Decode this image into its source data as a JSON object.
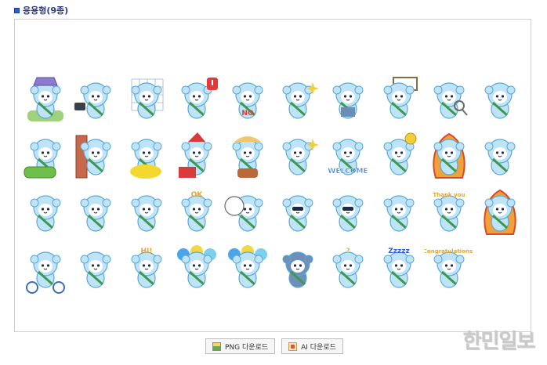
{
  "section": {
    "title": "응용형(9종)"
  },
  "stickers": {
    "rows": [
      [
        {
          "name": "purple-hat-mascot",
          "prop": "hat",
          "text": ""
        },
        {
          "name": "camera-mascot",
          "prop": "camera",
          "text": ""
        },
        {
          "name": "grid-window-mascot",
          "prop": "grid",
          "text": ""
        },
        {
          "name": "exclaim-mascot",
          "prop": "exclaim",
          "text": ""
        },
        {
          "name": "no-mascot",
          "prop": "textred",
          "text": "NO"
        },
        {
          "name": "sparkle-mascot",
          "prop": "sparkle",
          "text": ""
        },
        {
          "name": "book-mascot",
          "prop": "book",
          "text": ""
        },
        {
          "name": "sign-mascot",
          "prop": "sign",
          "text": ""
        },
        {
          "name": "magnifier-mascot",
          "prop": "magnifier",
          "text": ""
        },
        {
          "name": "wave-mascot",
          "prop": "none",
          "text": ""
        }
      ],
      [
        {
          "name": "car-mascot",
          "prop": "car",
          "text": ""
        },
        {
          "name": "door-peek-mascot",
          "prop": "door",
          "text": ""
        },
        {
          "name": "yellow-blob-mascot",
          "prop": "blob",
          "text": ""
        },
        {
          "name": "santa-gift-mascot",
          "prop": "santa",
          "text": ""
        },
        {
          "name": "harvest-mascot",
          "prop": "harvest",
          "text": ""
        },
        {
          "name": "cheer-mascot",
          "prop": "sparkle",
          "text": ""
        },
        {
          "name": "welcome-mascot",
          "prop": "welcome",
          "text": "WELCOME"
        },
        {
          "name": "sleep-idea-mascot",
          "prop": "idea",
          "text": ""
        },
        {
          "name": "fire-angry-mascot",
          "prop": "fire",
          "text": ""
        },
        {
          "name": "shy-mascot",
          "prop": "none",
          "text": ""
        }
      ],
      [
        {
          "name": "fan-mascot",
          "prop": "none",
          "text": ""
        },
        {
          "name": "jump-mascot",
          "prop": "none",
          "text": ""
        },
        {
          "name": "mask-mascot",
          "prop": "none",
          "text": ""
        },
        {
          "name": "ok-mascot",
          "prop": "textyellow",
          "text": "OK"
        },
        {
          "name": "speech-bubble-mascot",
          "prop": "bubble",
          "text": ""
        },
        {
          "name": "sunglasses-mascot",
          "prop": "sunglasses",
          "text": ""
        },
        {
          "name": "shopping-mascot",
          "prop": "sunglasses",
          "text": ""
        },
        {
          "name": "sweep-mascot",
          "prop": "none",
          "text": ""
        },
        {
          "name": "thank-you-mascot",
          "prop": "textyellow",
          "text": "Thank you"
        },
        {
          "name": "burnout-mascot",
          "prop": "fire",
          "text": ""
        }
      ],
      [
        {
          "name": "bicycle-mascot",
          "prop": "bike",
          "text": ""
        },
        {
          "name": "run-mascot",
          "prop": "none",
          "text": ""
        },
        {
          "name": "hi-mascot",
          "prop": "textyellow",
          "text": "HI!"
        },
        {
          "name": "balloon-mascot",
          "prop": "balloons",
          "text": ""
        },
        {
          "name": "balloon-small-mascot",
          "prop": "balloons",
          "text": ""
        },
        {
          "name": "sad-mascot",
          "prop": "dark",
          "text": ""
        },
        {
          "name": "question-mascot",
          "prop": "question",
          "text": "?"
        },
        {
          "name": "sleepy-mascot",
          "prop": "sleep",
          "text": "Zzzzz"
        },
        {
          "name": "congrats-mascot",
          "prop": "textyellow",
          "text": "Congratulations!"
        }
      ]
    ]
  },
  "downloads": {
    "png_label": "PNG 다운로드",
    "ai_label": "AI 다운로드"
  },
  "watermark": {
    "text": "한민일보"
  },
  "colors": {
    "mascot": "#bfe3f7",
    "mascot_outline": "#5ba8d6",
    "sash": "#3d9a4d",
    "accent_blue": "#2d5fd6"
  }
}
